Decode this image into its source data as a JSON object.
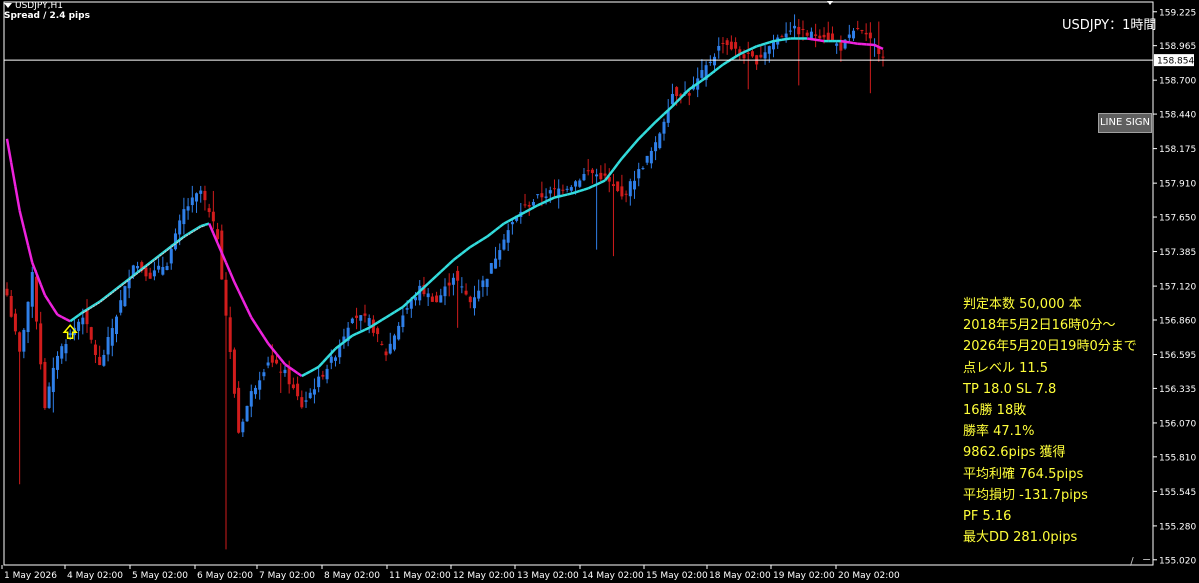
{
  "header": {
    "symbol_period": "USDJPY,H1",
    "spread": "Spread / 2.4 pips"
  },
  "symbol_title": "USDJPY：1時間",
  "line_sign_button": "LINE SIGN",
  "current_price_label": "158.854",
  "stats": [
    "判定本数 50,000 本",
    "2018年5月2日16時0分～",
    "2026年5月20日19時0分まで",
    "点レベル 11.5",
    "TP 18.0 SL 7.8",
    "16勝 18敗",
    "勝率 47.1%",
    "9862.6pips 獲得",
    "平均利確 764.5pips",
    "平均損切 -131.7pips",
    "PF 5.16",
    "最大DD 281.0pips"
  ],
  "colors": {
    "background": "#000000",
    "bull": "#2f7fe8",
    "bear": "#d01c1c",
    "ma_up": "#33dddd",
    "ma_down": "#ee22dd",
    "stats_text": "#ffff3a",
    "arrow": "#ffff00"
  },
  "chart_data": {
    "type": "candlestick",
    "ylim": [
      154.98,
      159.3
    ],
    "y_ticks": [
      "159.225",
      "158.965",
      "158.700",
      "158.440",
      "158.175",
      "157.910",
      "157.650",
      "157.385",
      "157.120",
      "156.860",
      "156.595",
      "156.335",
      "156.070",
      "155.810",
      "155.545",
      "155.280",
      "155.020"
    ],
    "x_ticks": [
      "1 May 2026",
      "4 May 02:00",
      "5 May 02:00",
      "6 May 02:00",
      "7 May 02:00",
      "8 May 02:00",
      "11 May 02:00",
      "12 May 02:00",
      "13 May 02:00",
      "14 May 02:00",
      "15 May 02:00",
      "18 May 02:00",
      "19 May 02:00",
      "20 May 02:00"
    ],
    "current_price": 158.854,
    "close_anchors": [
      [
        0,
        157.05
      ],
      [
        3,
        156.6
      ],
      [
        6,
        157.2
      ],
      [
        9,
        156.2
      ],
      [
        12,
        156.6
      ],
      [
        15,
        156.75
      ],
      [
        18,
        156.9
      ],
      [
        22,
        156.5
      ],
      [
        26,
        156.9
      ],
      [
        30,
        157.3
      ],
      [
        34,
        157.2
      ],
      [
        38,
        157.3
      ],
      [
        42,
        157.7
      ],
      [
        46,
        157.85
      ],
      [
        50,
        157.5
      ],
      [
        53,
        156.6
      ],
      [
        55,
        156.0
      ],
      [
        58,
        156.3
      ],
      [
        62,
        156.55
      ],
      [
        66,
        156.45
      ],
      [
        70,
        156.2
      ],
      [
        74,
        156.4
      ],
      [
        78,
        156.6
      ],
      [
        82,
        156.9
      ],
      [
        86,
        156.85
      ],
      [
        90,
        156.6
      ],
      [
        94,
        156.9
      ],
      [
        98,
        157.1
      ],
      [
        102,
        157.0
      ],
      [
        106,
        157.2
      ],
      [
        110,
        157.0
      ],
      [
        114,
        157.2
      ],
      [
        118,
        157.5
      ],
      [
        122,
        157.7
      ],
      [
        126,
        157.8
      ],
      [
        130,
        157.85
      ],
      [
        134,
        157.9
      ],
      [
        138,
        158.0
      ],
      [
        142,
        157.95
      ],
      [
        146,
        157.8
      ],
      [
        150,
        158.0
      ],
      [
        154,
        158.2
      ],
      [
        158,
        158.6
      ],
      [
        162,
        158.6
      ],
      [
        166,
        158.8
      ],
      [
        170,
        159.0
      ],
      [
        174,
        158.9
      ],
      [
        178,
        158.85
      ],
      [
        182,
        159.0
      ],
      [
        186,
        159.1
      ],
      [
        190,
        159.05
      ],
      [
        194,
        159.05
      ],
      [
        198,
        158.95
      ],
      [
        202,
        159.1
      ],
      [
        206,
        158.96
      ],
      [
        208,
        158.9
      ]
    ],
    "spikes": [
      {
        "i": 3,
        "low": 155.6
      },
      {
        "i": 11,
        "low": 156.15
      },
      {
        "i": 52,
        "low": 155.1
      },
      {
        "i": 49,
        "high": 157.85
      },
      {
        "i": 65,
        "low": 156.3
      },
      {
        "i": 107,
        "low": 156.8
      },
      {
        "i": 140,
        "low": 157.4
      },
      {
        "i": 144,
        "low": 157.35
      },
      {
        "i": 176,
        "low": 158.63
      },
      {
        "i": 188,
        "low": 158.66
      },
      {
        "i": 205,
        "low": 158.6
      },
      {
        "i": 207,
        "high": 159.15
      }
    ],
    "ma_anchors": [
      [
        0,
        158.25
      ],
      [
        3,
        157.7
      ],
      [
        6,
        157.3
      ],
      [
        9,
        157.05
      ],
      [
        12,
        156.9
      ],
      [
        15,
        156.85
      ],
      [
        18,
        156.92
      ],
      [
        22,
        157.0
      ],
      [
        26,
        157.1
      ],
      [
        30,
        157.2
      ],
      [
        34,
        157.3
      ],
      [
        38,
        157.4
      ],
      [
        42,
        157.5
      ],
      [
        46,
        157.58
      ],
      [
        48,
        157.6
      ],
      [
        50,
        157.45
      ],
      [
        54,
        157.15
      ],
      [
        58,
        156.88
      ],
      [
        62,
        156.68
      ],
      [
        66,
        156.52
      ],
      [
        70,
        156.43
      ],
      [
        74,
        156.5
      ],
      [
        78,
        156.64
      ],
      [
        82,
        156.74
      ],
      [
        86,
        156.8
      ],
      [
        90,
        156.88
      ],
      [
        94,
        156.96
      ],
      [
        98,
        157.08
      ],
      [
        102,
        157.2
      ],
      [
        106,
        157.32
      ],
      [
        110,
        157.42
      ],
      [
        114,
        157.5
      ],
      [
        118,
        157.6
      ],
      [
        122,
        157.67
      ],
      [
        126,
        157.74
      ],
      [
        130,
        157.8
      ],
      [
        134,
        157.83
      ],
      [
        138,
        157.87
      ],
      [
        142,
        157.93
      ],
      [
        146,
        158.1
      ],
      [
        150,
        158.25
      ],
      [
        154,
        158.38
      ],
      [
        158,
        158.5
      ],
      [
        162,
        158.63
      ],
      [
        166,
        158.72
      ],
      [
        170,
        158.82
      ],
      [
        174,
        158.9
      ],
      [
        178,
        158.96
      ],
      [
        182,
        159.0
      ],
      [
        186,
        159.02
      ],
      [
        190,
        159.02
      ],
      [
        194,
        159.0
      ],
      [
        198,
        159.0
      ],
      [
        202,
        158.98
      ],
      [
        206,
        158.97
      ],
      [
        208,
        158.94
      ]
    ]
  }
}
